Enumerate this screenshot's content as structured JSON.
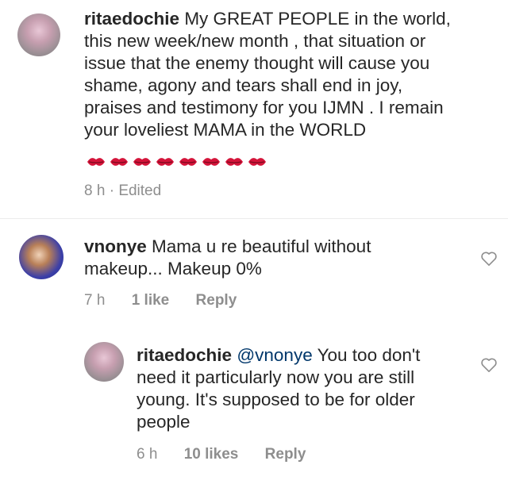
{
  "comments": [
    {
      "username": "ritaedochie",
      "text": "My GREAT PEOPLE in the world, this new week/new month , that situation or issue that the enemy thought will cause you shame, agony and tears shall end in joy, praises and testimony for you IJMN . I remain your loveliest MAMA in the WORLD",
      "emoji": "kiss-mark-icon x8",
      "time": "8 h",
      "separator": "·",
      "edited": "Edited"
    },
    {
      "username": "vnonye",
      "text": "Mama u re beautiful without makeup... Makeup 0%",
      "time": "7 h",
      "likes": "1 like",
      "reply": "Reply"
    },
    {
      "username": "ritaedochie",
      "mention": "@vnonye",
      "text": "You too don't need it particularly now you are still young. It's supposed to be for older people",
      "time": "6 h",
      "likes": "10 likes",
      "reply": "Reply"
    }
  ],
  "colors": {
    "text": "#262626",
    "muted": "#8e8e8e",
    "mention": "#00376b"
  }
}
